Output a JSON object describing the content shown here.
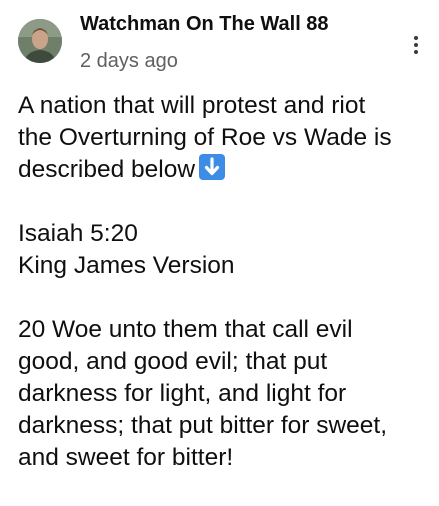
{
  "post": {
    "author": "Watchman On The Wall 88",
    "timestamp": "2 days ago",
    "avatar_icon": "user-avatar-photo",
    "menu_icon": "more-vertical-icon",
    "body": {
      "intro_lines": [
        "A nation that will protest and riot",
        "the Overturning of Roe vs Wade is",
        "described below"
      ],
      "intro_emoji": "down-arrow-emoji",
      "reference": "Isaiah 5:20",
      "version": "King James Version",
      "verse_lines": [
        "20 Woe unto them that call evil",
        "good, and good evil; that put",
        "darkness for light, and light for",
        "darkness; that put bitter for sweet,",
        "and sweet for bitter!"
      ]
    }
  },
  "colors": {
    "text": "#0f0f0f",
    "secondary_text": "#606060",
    "emoji_blue": "#3d8de6"
  }
}
